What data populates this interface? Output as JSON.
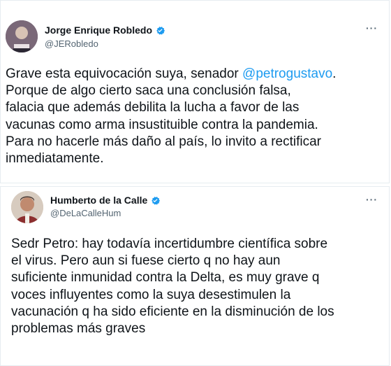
{
  "tweets": [
    {
      "author_name": "Jorge Enrique Robledo",
      "handle": "@JERobledo",
      "text_before": "Grave esta equivocación suya, senador ",
      "mention": "@petrogustavo",
      "text_after": ".\nPorque de algo cierto saca una conclusión falsa,\nfalacia que además debilita la lucha a favor de las\nvacunas como arma insustituible contra la pandemia.\nPara no hacerle más daño al país, lo invito a rectificar\ninmediatamente.",
      "more_label": "···",
      "verified_icon": "verified-badge-icon"
    },
    {
      "author_name": "Humberto de la Calle",
      "handle": "@DeLaCalleHum",
      "text": "Sedr Petro: hay todavía incertidumbre científica sobre\nel virus. Pero aun si fuese cierto q no hay aun\nsuficiente inmunidad contra la Delta, es muy grave q\nvoces influyentes como la suya desestimulen la\nvacunación q ha sido eficiente en la disminución de los\nproblemas más graves",
      "more_label": "···",
      "verified_icon": "verified-badge-icon"
    }
  ],
  "colors": {
    "link": "#1d9bf0",
    "verified": "#1d9bf0",
    "secondary_text": "#536471",
    "primary_text": "#0f1419"
  }
}
